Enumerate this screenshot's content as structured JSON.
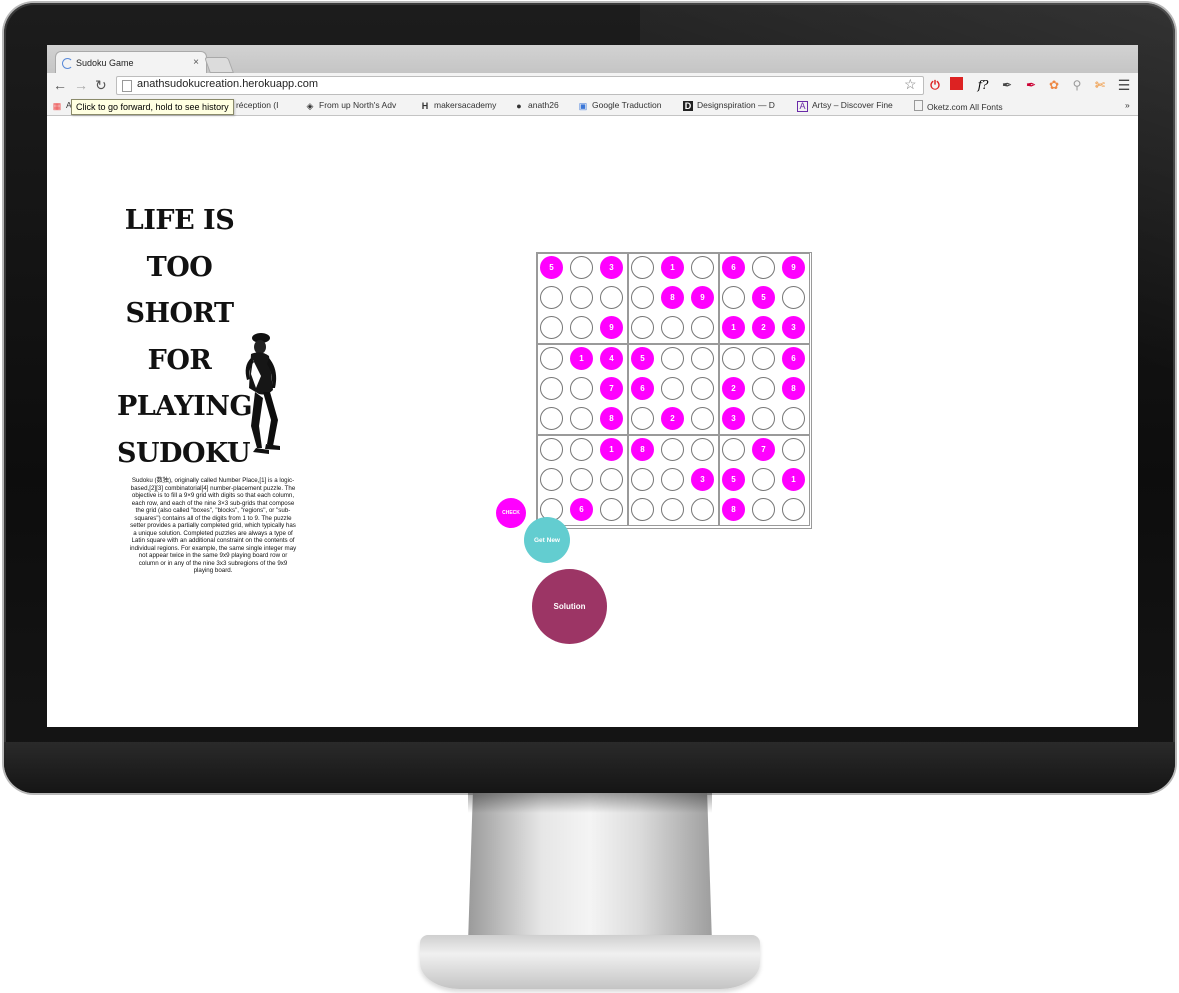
{
  "browser": {
    "tab_title": "Sudoku Game",
    "tab_close": "×",
    "url": "anathsudokucreation.herokuapp.com",
    "tooltip": "Click to go forward, hold to see history",
    "bookmarks": [
      {
        "icon": "grid-icon",
        "label": "A"
      },
      {
        "icon": "page-icon",
        "label": "le réception (I"
      },
      {
        "icon": "arrow-icon",
        "label": "From up North's Adv"
      },
      {
        "icon": "h-icon",
        "label": "makersacademy"
      },
      {
        "icon": "github-icon",
        "label": "anath26"
      },
      {
        "icon": "translate-icon",
        "label": "Google Traduction"
      },
      {
        "icon": "d-icon",
        "label": "Designspiration — D"
      },
      {
        "icon": "artsy-icon",
        "label": "Artsy – Discover Fine"
      },
      {
        "icon": "page-icon",
        "label": "Oketz.com All Fonts"
      }
    ],
    "bookmarks_overflow": "»"
  },
  "sidebar": {
    "slogan_lines": [
      "LIFE IS",
      "TOO",
      "SHORT",
      "FOR",
      "PLAYING",
      "SUDOKU"
    ],
    "description": "Sudoku (数独), originally called Number Place,[1] is a logic-based,[2][3] combinatorial[4] number-placement puzzle. The objective is to fill a 9×9 grid with digits so that each column, each row, and each of the nine 3×3 sub-grids that compose the grid (also called \"boxes\", \"blocks\", \"regions\", or \"sub-squares\") contains all of the digits from 1 to 9. The puzzle setter provides a partially completed grid, which typically has a unique solution. Completed puzzles are always a type of Latin square with an additional constraint on the contents of individual regions. For example, the same single integer may not appear twice in the same 9x9 playing board row or column or in any of the nine 3x3 subregions of the 9x9 playing board."
  },
  "sudoku": {
    "grid": [
      [
        "5",
        "",
        "3",
        "",
        "1",
        "",
        "6",
        "",
        "9"
      ],
      [
        "",
        "",
        "",
        "",
        "8",
        "9",
        "",
        "5",
        ""
      ],
      [
        "",
        "",
        "9",
        "",
        "",
        "",
        "1",
        "2",
        "3"
      ],
      [
        "",
        "1",
        "4",
        "5",
        "",
        "",
        "",
        "",
        "6"
      ],
      [
        "",
        "",
        "7",
        "6",
        "",
        "",
        "2",
        "",
        "8"
      ],
      [
        "",
        "",
        "8",
        "",
        "2",
        "",
        "3",
        "",
        ""
      ],
      [
        "",
        "",
        "1",
        "8",
        "",
        "",
        "",
        "7",
        ""
      ],
      [
        "",
        "",
        "",
        "",
        "",
        "3",
        "5",
        "",
        "1"
      ],
      [
        "",
        "6",
        "",
        "",
        "",
        "",
        "8",
        "",
        ""
      ]
    ]
  },
  "buttons": {
    "check": "CHECK",
    "get_new": "Get New",
    "solution": "Solution"
  },
  "colors": {
    "filled_cell": "#ff00ff",
    "get_new": "#63cdd0",
    "solution": "#9c3565"
  }
}
